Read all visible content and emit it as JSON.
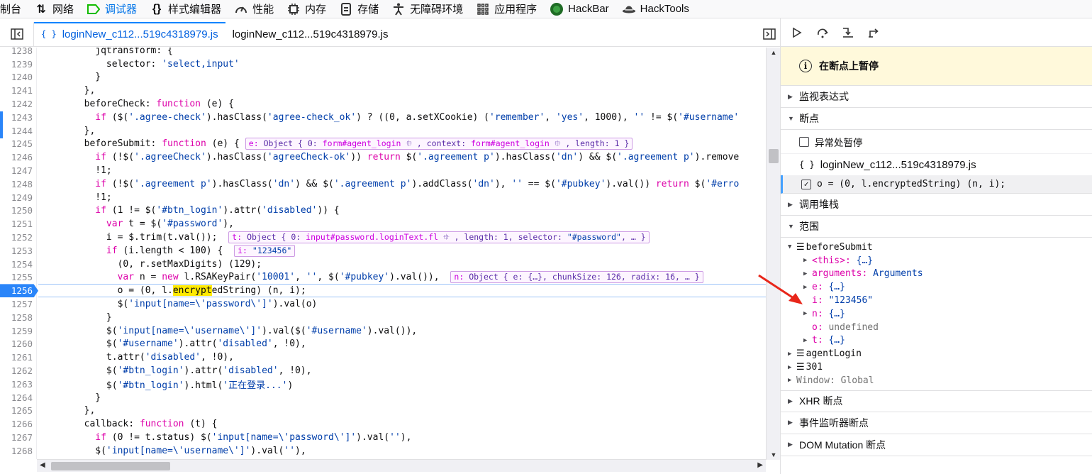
{
  "toolbar": {
    "items": [
      {
        "label": "制台",
        "icon": "console-icon"
      },
      {
        "label": "网络",
        "icon": "network-icon"
      },
      {
        "label": "调试器",
        "icon": "debugger-icon"
      },
      {
        "label": "样式编辑器",
        "icon": "style-editor-icon"
      },
      {
        "label": "性能",
        "icon": "performance-icon"
      },
      {
        "label": "内存",
        "icon": "memory-icon"
      },
      {
        "label": "存储",
        "icon": "storage-icon"
      },
      {
        "label": "无障碍环境",
        "icon": "accessibility-icon"
      },
      {
        "label": "应用程序",
        "icon": "application-icon"
      },
      {
        "label": "HackBar",
        "icon": "hackbar-icon"
      },
      {
        "label": "HackTools",
        "icon": "hacktools-icon"
      }
    ]
  },
  "editor": {
    "tabs": [
      {
        "label": "loginNew_c112...519c4318979.js",
        "selected": true
      },
      {
        "label": "loginNew_c112...519c4318979.js",
        "selected": false
      }
    ]
  },
  "code": {
    "lines": [
      {
        "n": "1238"
      },
      {
        "n": "1239"
      },
      {
        "n": "1240"
      },
      {
        "n": "1241"
      },
      {
        "n": "1242"
      },
      {
        "n": "1243"
      },
      {
        "n": "1244"
      },
      {
        "n": "1245"
      },
      {
        "n": "1246"
      },
      {
        "n": "1247"
      },
      {
        "n": "1248"
      },
      {
        "n": "1249"
      },
      {
        "n": "1250"
      },
      {
        "n": "1251"
      },
      {
        "n": "1252"
      },
      {
        "n": "1253"
      },
      {
        "n": "1254"
      },
      {
        "n": "1255"
      },
      {
        "n": "1256"
      },
      {
        "n": "1257"
      },
      {
        "n": "1258"
      },
      {
        "n": "1259"
      },
      {
        "n": "1260"
      },
      {
        "n": "1261"
      },
      {
        "n": "1262"
      },
      {
        "n": "1263"
      },
      {
        "n": "1264"
      },
      {
        "n": "1265"
      },
      {
        "n": "1266"
      },
      {
        "n": "1267"
      },
      {
        "n": "1268"
      },
      {
        "n": "1269"
      }
    ]
  },
  "sidebar": {
    "paused_label": "在断点上暂停",
    "watch_label": "监视表达式",
    "breakpoints_label": "断点",
    "pause_on_exceptions": "异常处暂停",
    "bp_file": "loginNew_c112...519c4318979.js",
    "bp_entry": "o = (0, l.encryptedString) (n, i);",
    "callstack_label": "调用堆栈",
    "scopes_label": "范围",
    "scope": {
      "block": "beforeSubmit",
      "this_key": "<this>",
      "this_val": "{…}",
      "arguments_key": "arguments",
      "arguments_val": "Arguments",
      "e_key": "e",
      "e_val": "{…}",
      "i_key": "i",
      "i_val": "\"123456\"",
      "n_key": "n",
      "n_val": "{…}",
      "o_key": "o",
      "o_val": "undefined",
      "t_key": "t",
      "t_val": "{…}",
      "agent": "agentLogin",
      "num": "301",
      "window": "Window: Global"
    },
    "xhr_label": "XHR 断点",
    "event_label": "事件监听器断点",
    "dom_label": "DOM Mutation 断点"
  },
  "colors": {
    "accent": "#0a84ff",
    "breakpoint": "#2a85f9",
    "paused_bg": "#fff9db",
    "keyword": "#dd00a9",
    "string": "#003eaa",
    "arrow": "#e8261a"
  }
}
